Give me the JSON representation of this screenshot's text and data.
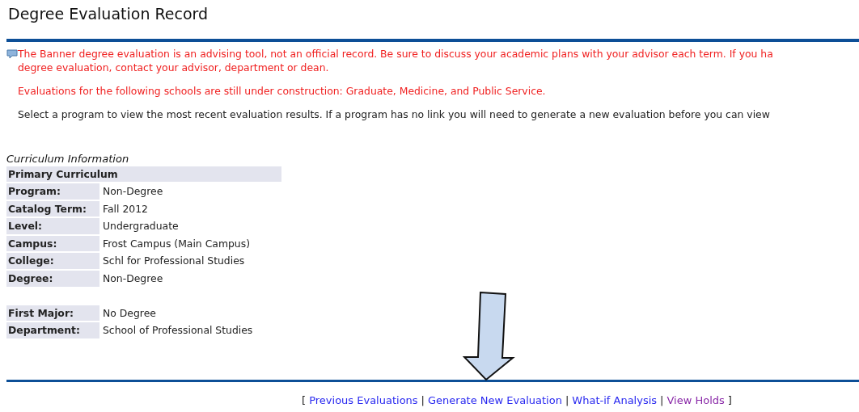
{
  "title": "Degree Evaluation Record",
  "messages": [
    {
      "kind": "warning",
      "lines": [
        "The Banner degree evaluation is an advising tool, not an official record. Be sure to discuss your academic plans with your advisor each term. If you ha",
        "degree evaluation, contact your advisor, department or dean."
      ]
    },
    {
      "kind": "warning",
      "lines": [
        "Evaluations for the following schools are still under construction: Graduate, Medicine, and Public Service."
      ]
    },
    {
      "kind": "info",
      "lines": [
        "Select a program to view the most recent evaluation results. If a program has no link you will need to generate a new evaluation before you can view"
      ]
    }
  ],
  "curriculum": {
    "caption": "Curriculum Information",
    "header": "Primary Curriculum",
    "groups": [
      [
        {
          "label": "Program:",
          "value": "Non-Degree"
        },
        {
          "label": "Catalog Term:",
          "value": "Fall 2012"
        },
        {
          "label": "Level:",
          "value": "Undergraduate"
        },
        {
          "label": "Campus:",
          "value": "Frost Campus (Main Campus)"
        },
        {
          "label": "College:",
          "value": "Schl for Professional Studies"
        },
        {
          "label": "Degree:",
          "value": "Non-Degree"
        }
      ],
      [
        {
          "label": "First Major:",
          "value": "No Degree"
        },
        {
          "label": "Department:",
          "value": "School of Professional Studies"
        }
      ]
    ]
  },
  "links": {
    "open": "[",
    "separator": "|",
    "close": "]",
    "items": [
      {
        "label": "Previous Evaluations",
        "visited": false
      },
      {
        "label": "Generate New Evaluation",
        "visited": false
      },
      {
        "label": "What-if Analysis",
        "visited": false
      },
      {
        "label": "View Holds",
        "visited": true
      }
    ]
  }
}
